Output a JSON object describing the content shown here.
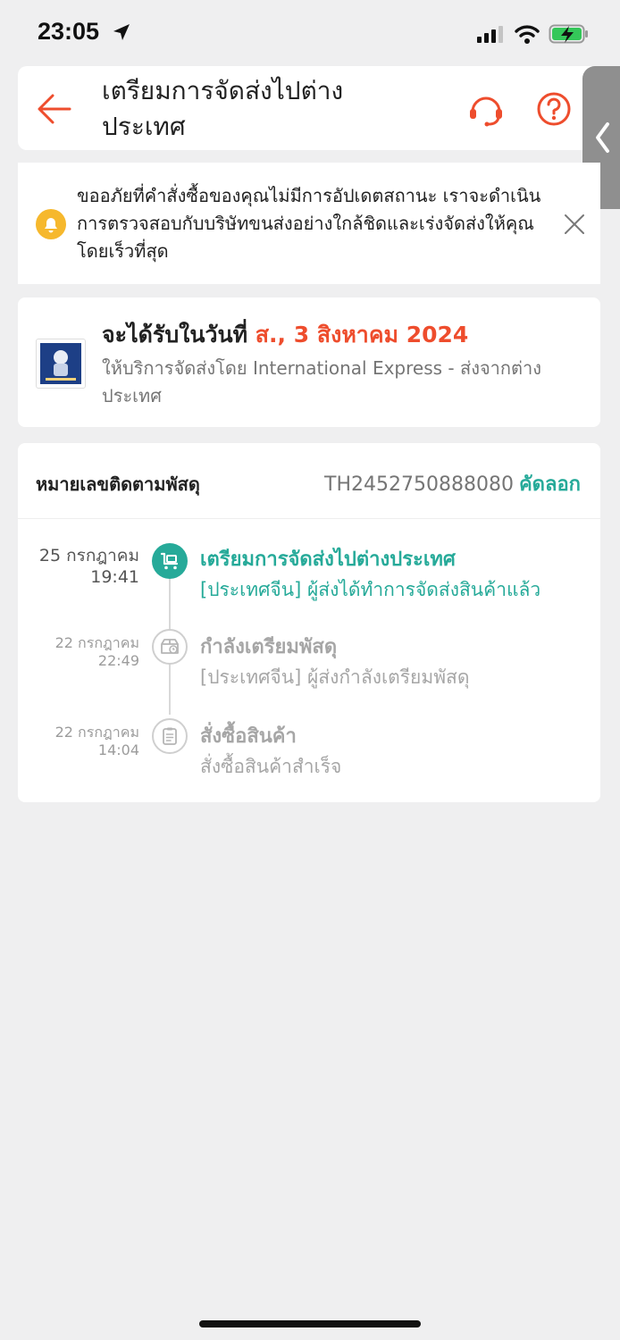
{
  "status_bar": {
    "time": "23:05"
  },
  "header": {
    "title": "เตรียมการจัดส่งไปต่างประเทศ",
    "accent_color": "#ee4d2d"
  },
  "notice": {
    "text": "ขออภัยที่คำสั่งซื้อของคุณไม่มีการอัปเดตสถานะ เราจะดำเนินการตรวจสอบกับบริษัทขนส่งอย่างใกล้ชิดและเร่งจัดส่งให้คุณโดยเร็วที่สุด",
    "icon": "bell-icon"
  },
  "delivery": {
    "label": "จะได้รับในวันที่ ",
    "date": "ส., 3 สิงหาคม 2024",
    "service": "ให้บริการจัดส่งโดย International Express - ส่งจากต่างประเทศ"
  },
  "tracking": {
    "label": "หมายเลขติดตามพัสดุ",
    "number": "TH2452750888080",
    "copy_label": "คัดลอก",
    "accent_color": "#26aa99",
    "events": [
      {
        "date": "25 กรกฎาคม",
        "time": "19:41",
        "title": "เตรียมการจัดส่งไปต่างประเทศ",
        "description": "[ประเทศจีน] ผู้ส่งได้ทำการจัดส่งสินค้าแล้ว",
        "icon": "cart-icon",
        "active": true
      },
      {
        "date": "22 กรกฎาคม",
        "time": "22:49",
        "title": "กำลังเตรียมพัสดุ",
        "description": "[ประเทศจีน] ผู้ส่งกำลังเตรียมพัสดุ",
        "icon": "package-clock-icon",
        "active": false
      },
      {
        "date": "22 กรกฎาคม",
        "time": "14:04",
        "title": "สั่งซื้อสินค้า",
        "description": "สั่งซื้อสินค้าสำเร็จ",
        "icon": "clipboard-icon",
        "active": false
      }
    ]
  }
}
